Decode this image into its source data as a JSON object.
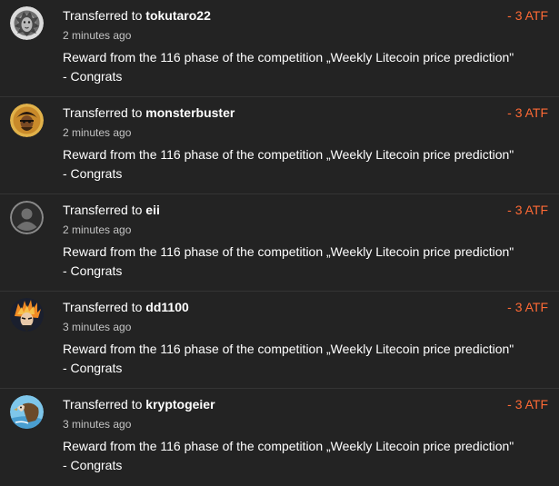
{
  "transactions": [
    {
      "prefix": "Transferred to",
      "username": "tokutaro22",
      "time": "2 minutes ago",
      "description": "Reward from the 116 phase of the competition „Weekly Litecoin price prediction\" - Congrats",
      "amount": "- 3 ATF",
      "avatar": "lion-avatar-icon"
    },
    {
      "prefix": "Transferred to",
      "username": "monsterbuster",
      "time": "2 minutes ago",
      "description": "Reward from the 116 phase of the competition „Weekly Litecoin price prediction\" - Congrats",
      "amount": "- 3 ATF",
      "avatar": "pirate-avatar-icon"
    },
    {
      "prefix": "Transferred to",
      "username": "eii",
      "time": "2 minutes ago",
      "description": "Reward from the 116 phase of the competition „Weekly Litecoin price prediction\" - Congrats",
      "amount": "- 3 ATF",
      "avatar": "default-user-avatar-icon"
    },
    {
      "prefix": "Transferred to",
      "username": "dd1100",
      "time": "3 minutes ago",
      "description": "Reward from the 116 phase of the competition „Weekly Litecoin price prediction\" - Congrats",
      "amount": "- 3 ATF",
      "avatar": "anime-avatar-icon"
    },
    {
      "prefix": "Transferred to",
      "username": "kryptogeier",
      "time": "3 minutes ago",
      "description": "Reward from the 116 phase of the competition „Weekly Litecoin price prediction\" - Congrats",
      "amount": "- 3 ATF",
      "avatar": "vulture-avatar-icon"
    }
  ],
  "colors": {
    "background": "#232323",
    "amount": "#ff6a35",
    "divider": "#343434",
    "muted_text": "#c4c4c4"
  }
}
